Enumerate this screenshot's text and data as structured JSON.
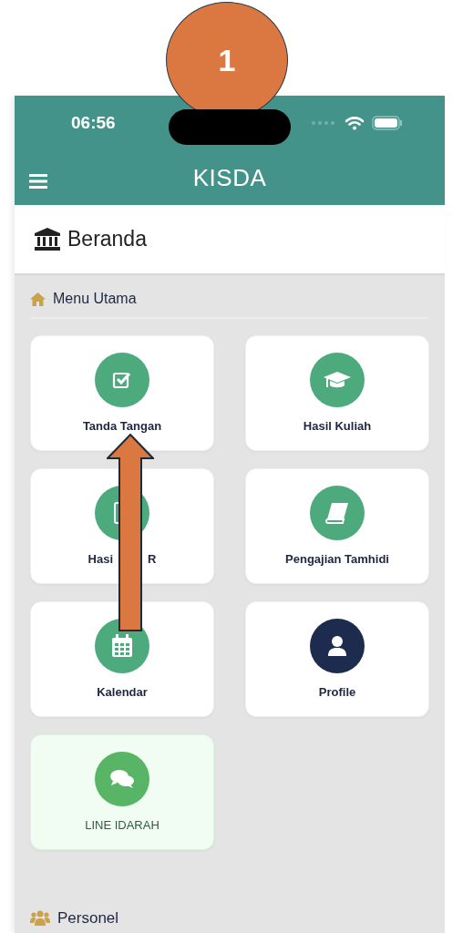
{
  "annotation": {
    "step": "1"
  },
  "status_bar": {
    "time": "06:56"
  },
  "header": {
    "title": "KISDA"
  },
  "page_title": "Beranda",
  "menu_section": {
    "title": "Menu Utama"
  },
  "tiles": [
    {
      "label_parts": [
        "Tanda Tangan"
      ],
      "color": "#4caa7d",
      "kind": "plain"
    },
    {
      "label_parts": [
        "Hasil Kuliah"
      ],
      "color": "#4caa7d",
      "kind": "plain"
    },
    {
      "label_parts": [
        "Hasi",
        "R"
      ],
      "color": "#4caa7d",
      "kind": "plain"
    },
    {
      "label_parts": [
        "Pengajian Tamhidi"
      ],
      "color": "#4caa7d",
      "kind": "plain"
    },
    {
      "label_parts": [
        "Kalendar"
      ],
      "color": "#4caa7d",
      "kind": "plain"
    },
    {
      "label_parts": [
        "Profile"
      ],
      "color": "#1d2c4e",
      "kind": "plain"
    },
    {
      "label_parts": [
        "LINE IDARAH"
      ],
      "color": "#58b565",
      "kind": "highlight"
    }
  ],
  "personel_section": {
    "title": "Personel"
  }
}
